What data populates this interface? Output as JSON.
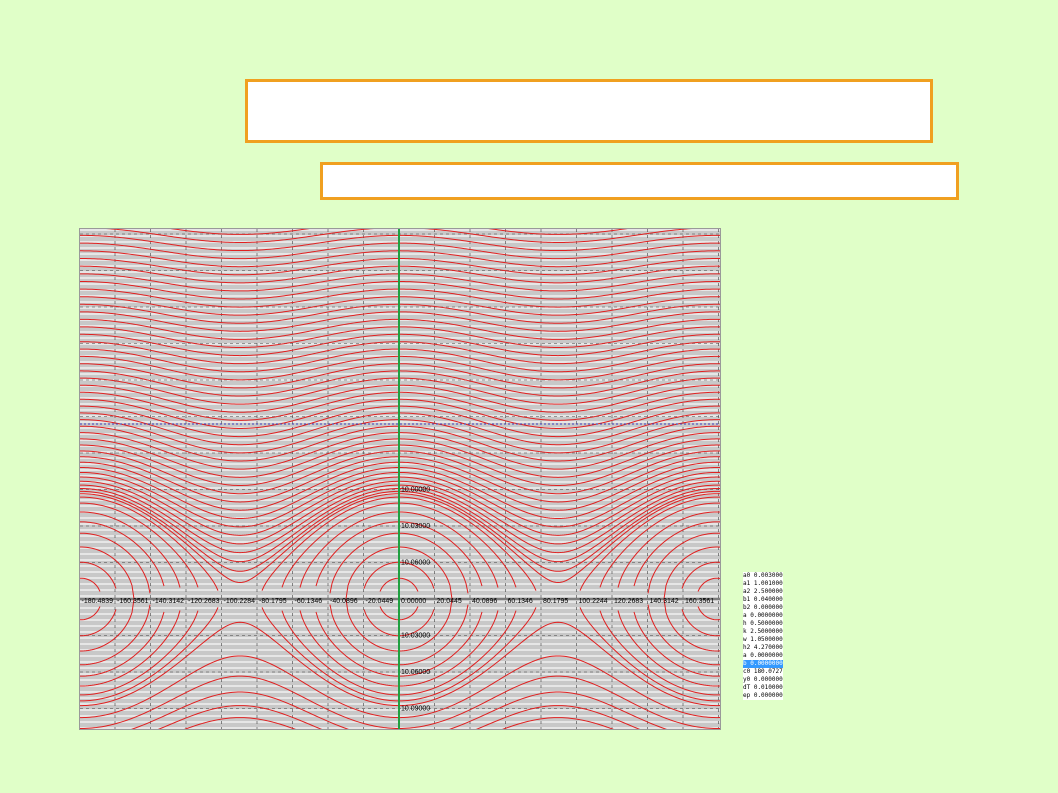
{
  "slide": {
    "title": "",
    "subtitle": ""
  },
  "plot": {
    "x_ticks": [
      "-180.4839",
      "-160.3561",
      "-140.3142",
      "-120.2683",
      "-100.2284",
      "-80.1795",
      "-60.1346",
      "-40.0896",
      "-20.0449",
      "0.00000",
      "20.0445",
      "40.0896",
      "60.1346",
      "80.1795",
      "100.2244",
      "120.2683",
      "140.3142",
      "160.3561"
    ],
    "y_ticks_upper": [
      "10.06000",
      "10.03000",
      "10.00000"
    ],
    "y_ticks_lower": [
      "10.03000",
      "10.06000",
      "10.09000"
    ],
    "colors": {
      "curve": "#e02020",
      "axis_v": "#20a040",
      "axis_h": "#4040c0",
      "grid": "#404040",
      "band": "#ffffff"
    }
  },
  "params": [
    {
      "text": "a0 0.00300000",
      "selected": false
    },
    {
      "text": "a1 1.00100000",
      "selected": false
    },
    {
      "text": "a2 2.50000000",
      "selected": false
    },
    {
      "text": "b1 0.04000000",
      "selected": false
    },
    {
      "text": "b2 0.00000000",
      "selected": false
    },
    {
      "text": "a 0.0000000",
      "selected": false
    },
    {
      "text": "h 0.5000000",
      "selected": false
    },
    {
      "text": "k 2.5000000",
      "selected": false
    },
    {
      "text": "w 1.0500000",
      "selected": false
    },
    {
      "text": "h2 4.2700000",
      "selected": false
    },
    {
      "text": "a 0.0000000",
      "selected": false
    },
    {
      "text": "b 0.0000000",
      "selected": true
    },
    {
      "text": "c0 180.0727096",
      "selected": false
    },
    {
      "text": "y0 0.00000000",
      "selected": false
    },
    {
      "text": "dT 0.0100000",
      "selected": false
    },
    {
      "text": "ep 0.0000000",
      "selected": false
    }
  ]
}
